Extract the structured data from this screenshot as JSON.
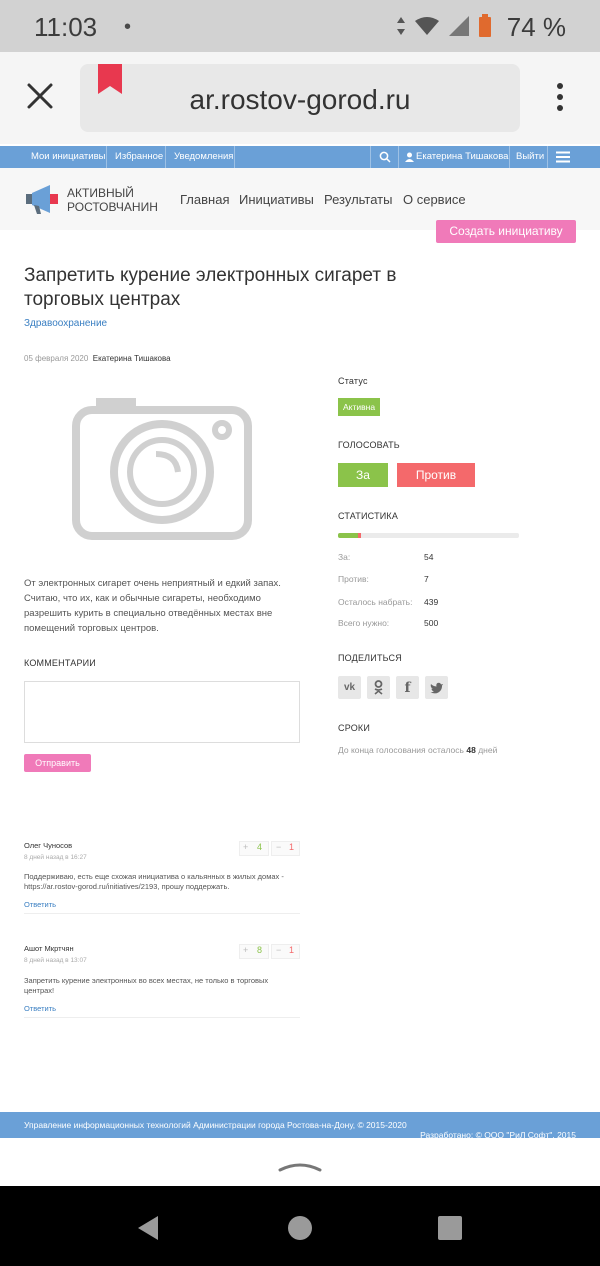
{
  "status_bar": {
    "time": "11:03",
    "dot": "•",
    "battery": "74 %"
  },
  "browser": {
    "url": "ar.rostov-gorod.ru"
  },
  "topbar": {
    "my_initiatives": "Мои инициативы",
    "favorites": "Избранное",
    "notifications": "Уведомления",
    "user": "Екатерина Тишакова",
    "logout": "Выйти"
  },
  "header": {
    "brand_line1": "АКТИВНЫЙ",
    "brand_line2": "РОСТОВЧАНИН",
    "nav": [
      "Главная",
      "Инициативы",
      "Результаты",
      "О сервисе"
    ],
    "create_button": "Создать инициативу"
  },
  "initiative": {
    "title": "Запретить курение электронных сигарет в торговых центрах",
    "category": "Здравоохранение",
    "date": "05 февраля 2020",
    "author": "Екатерина Тишакова",
    "description": "От электронных сигарет очень неприятный и едкий запах. Считаю, что их, как и обычные сигареты, необходимо разрешить курить в специально отведённых местах вне помещений торговых центров."
  },
  "sidebar": {
    "status_label": "Статус",
    "status_value": "Активна",
    "vote_label": "ГОЛОСОВАТЬ",
    "vote_for": "За",
    "vote_against": "Против",
    "stats_label": "СТАТИСТИКА",
    "progress": {
      "for": 54,
      "against": 7,
      "total": 500
    },
    "stats": [
      {
        "label": "За:",
        "value": "54"
      },
      {
        "label": "Против:",
        "value": "7"
      },
      {
        "label": "Осталось набрать:",
        "value": "439"
      },
      {
        "label": "Всего нужно:",
        "value": "500"
      }
    ],
    "share_label": "ПОДЕЛИТЬСЯ",
    "social": [
      "vk-icon",
      "odnoklassniki-icon",
      "facebook-icon",
      "twitter-icon"
    ],
    "deadline_label": "СРОКИ",
    "deadline_prefix": "До конца голосования осталось",
    "deadline_days": "48",
    "deadline_suffix": "дней"
  },
  "comments_section": {
    "label": "КОММЕНТАРИИ",
    "submit": "Отправить",
    "items": [
      {
        "name": "Олег Чуносов",
        "date": "8 дней назад в 16:27",
        "up": "4",
        "down": "1",
        "text": "Поддерживаю, есть еще схожая инициатива о кальянных в жилых домах - https://ar.rostov-gorod.ru/initiatives/2193, прошу поддержать.",
        "reply": "Ответить"
      },
      {
        "name": "Ашот Мкртчян",
        "date": "8 дней назад в 13:07",
        "up": "8",
        "down": "1",
        "text": "Запретить курение электронных во всех местах, не только в торговых центрах!",
        "reply": "Ответить"
      }
    ]
  },
  "footer": {
    "text": "Управление информационных технологий Администрации города Ростова-на-Дону, © 2015-2020",
    "dev": "Разработано: © ООО \"РиЛ Софт\", 2015"
  },
  "colors": {
    "blue": "#6aa0d7",
    "pink": "#f07ab9",
    "green": "#8bc34a",
    "red": "#f4696b"
  }
}
